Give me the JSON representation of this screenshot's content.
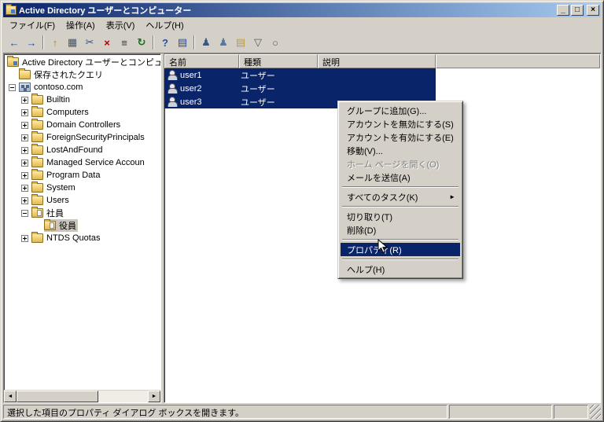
{
  "colors": {
    "selection": "#0a246a",
    "titlebar_start": "#0a246a",
    "titlebar_end": "#a6caf0",
    "window_face": "#d4d0c8",
    "inactive_selection": "#cac6bd"
  },
  "window": {
    "title": "Active Directory ユーザーとコンピューター",
    "controls": [
      {
        "name": "minimize",
        "glyph": "_"
      },
      {
        "name": "maximize",
        "glyph": "□"
      },
      {
        "name": "close",
        "glyph": "×"
      }
    ]
  },
  "menu_bar": {
    "items": [
      {
        "name": "file",
        "label": "ファイル(F)"
      },
      {
        "name": "action",
        "label": "操作(A)"
      },
      {
        "name": "view",
        "label": "表示(V)"
      },
      {
        "name": "help",
        "label": "ヘルプ(H)"
      }
    ]
  },
  "toolbar": {
    "buttons": [
      {
        "name": "back",
        "glyph": "←",
        "color": "#1e4fa8"
      },
      {
        "name": "forward",
        "glyph": "→",
        "color": "#1e4fa8"
      },
      {
        "sep": true
      },
      {
        "name": "up-one-level",
        "glyph": "↑",
        "color": "#b8860b"
      },
      {
        "name": "show-console-tree",
        "glyph": "▦",
        "color": "#44556a"
      },
      {
        "name": "cut",
        "glyph": "✂",
        "color": "#33507a"
      },
      {
        "name": "delete",
        "glyph": "×",
        "color": "#b00000"
      },
      {
        "name": "properties",
        "glyph": "≡",
        "color": "#333333"
      },
      {
        "name": "refresh",
        "glyph": "↻",
        "color": "#17691e"
      },
      {
        "sep": true
      },
      {
        "name": "help",
        "glyph": "?",
        "color": "#1e4fa8"
      },
      {
        "name": "export-list",
        "glyph": "▤",
        "color": "#1e4fa8"
      },
      {
        "sep": true
      },
      {
        "name": "new-user",
        "glyph": "♟",
        "color": "#35598c"
      },
      {
        "name": "new-group",
        "glyph": "♟",
        "color": "#5577aa"
      },
      {
        "name": "new-ou",
        "glyph": "▤",
        "color": "#c79a28"
      },
      {
        "name": "set-filter",
        "glyph": "▽",
        "color": "#556066"
      },
      {
        "name": "find",
        "glyph": "○",
        "color": "#556066"
      }
    ]
  },
  "tree": {
    "items": [
      {
        "name": "root",
        "label": "Active Directory ユーザーとコンピュ",
        "icon": "root",
        "level": 0,
        "expand": "none",
        "selected": false
      },
      {
        "name": "saved-queries",
        "label": "保存されたクエリ",
        "icon": "folder",
        "level": 1,
        "expand": "none",
        "selected": false
      },
      {
        "name": "contoso-com",
        "label": "contoso.com",
        "icon": "domain",
        "level": 1,
        "expand": "minus",
        "selected": false
      },
      {
        "name": "builtin",
        "label": "Builtin",
        "icon": "folder",
        "level": 2,
        "expand": "plus",
        "selected": false
      },
      {
        "name": "computers",
        "label": "Computers",
        "icon": "folder",
        "level": 2,
        "expand": "plus",
        "selected": false
      },
      {
        "name": "domain-controllers",
        "label": "Domain Controllers",
        "icon": "folder",
        "level": 2,
        "expand": "plus",
        "selected": false
      },
      {
        "name": "foreign-security-principals",
        "label": "ForeignSecurityPrincipals",
        "icon": "folder",
        "level": 2,
        "expand": "plus",
        "selected": false
      },
      {
        "name": "lost-and-found",
        "label": "LostAndFound",
        "icon": "folder",
        "level": 2,
        "expand": "plus",
        "selected": false
      },
      {
        "name": "managed-service-accounts",
        "label": "Managed Service Accoun",
        "icon": "folder",
        "level": 2,
        "expand": "plus",
        "selected": false
      },
      {
        "name": "program-data",
        "label": "Program Data",
        "icon": "folder",
        "level": 2,
        "expand": "plus",
        "selected": false
      },
      {
        "name": "system",
        "label": "System",
        "icon": "folder",
        "level": 2,
        "expand": "plus",
        "selected": false
      },
      {
        "name": "users",
        "label": "Users",
        "icon": "folder",
        "level": 2,
        "expand": "plus",
        "selected": false
      },
      {
        "name": "shain",
        "label": "社員",
        "icon": "ou",
        "level": 2,
        "expand": "minus",
        "selected": false
      },
      {
        "name": "yakuin",
        "label": "役員",
        "icon": "ou",
        "level": 3,
        "expand": "none",
        "selected": true
      },
      {
        "name": "ntds-quotas",
        "label": "NTDS Quotas",
        "icon": "folder",
        "level": 2,
        "expand": "plus",
        "selected": false
      }
    ]
  },
  "list": {
    "columns": [
      {
        "name": "name",
        "label": "名前",
        "width": 95
      },
      {
        "name": "type",
        "label": "種類",
        "width": 100
      },
      {
        "name": "description",
        "label": "説明",
        "width": 150
      }
    ],
    "rows": [
      {
        "name": "user1",
        "type": "ユーザー",
        "description": "",
        "selected": true
      },
      {
        "name": "user2",
        "type": "ユーザー",
        "description": "",
        "selected": true
      },
      {
        "name": "user3",
        "type": "ユーザー",
        "description": "",
        "selected": true
      }
    ]
  },
  "context_menu": {
    "items": [
      {
        "name": "add-to-group",
        "label": "グループに追加(G)..."
      },
      {
        "name": "disable-account",
        "label": "アカウントを無効にする(S)"
      },
      {
        "name": "enable-account",
        "label": "アカウントを有効にする(E)"
      },
      {
        "name": "move",
        "label": "移動(V)..."
      },
      {
        "name": "open-home-page",
        "label": "ホーム ページを開く(O)",
        "disabled": true
      },
      {
        "name": "send-mail",
        "label": "メールを送信(A)"
      },
      {
        "sep": true
      },
      {
        "name": "all-tasks",
        "label": "すべてのタスク(K)",
        "submenu": true
      },
      {
        "sep": true
      },
      {
        "name": "cut",
        "label": "切り取り(T)"
      },
      {
        "name": "delete",
        "label": "削除(D)"
      },
      {
        "sep": true
      },
      {
        "name": "properties",
        "label": "プロパティ(R)",
        "highlighted": true
      },
      {
        "sep": true
      },
      {
        "name": "help",
        "label": "ヘルプ(H)"
      }
    ]
  },
  "status_bar": {
    "text": "選択した項目のプロパティ ダイアログ ボックスを開きます。"
  }
}
